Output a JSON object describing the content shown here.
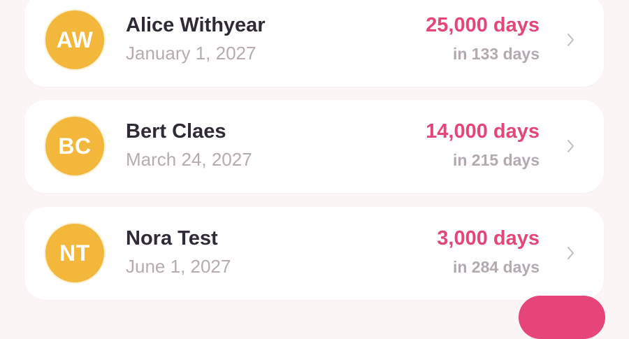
{
  "colors": {
    "background": "#fcf5f6",
    "card": "#ffffff",
    "avatar": "#f3b73c",
    "accent": "#e64577",
    "primary_text": "#2f2a35",
    "secondary_text": "#b5abb1"
  },
  "milestones": [
    {
      "initials": "AW",
      "name": "Alice Withyear",
      "date": "January 1, 2027",
      "milestone": "25,000 days",
      "countdown": "in 133 days",
      "icon": "chevron-right-icon"
    },
    {
      "initials": "BC",
      "name": "Bert Claes",
      "date": "March 24, 2027",
      "milestone": "14,000 days",
      "countdown": "in 215 days",
      "icon": "chevron-right-icon"
    },
    {
      "initials": "NT",
      "name": "Nora Test",
      "date": "June 1, 2027",
      "milestone": "3,000 days",
      "countdown": "in 284 days",
      "icon": "chevron-right-icon"
    }
  ]
}
